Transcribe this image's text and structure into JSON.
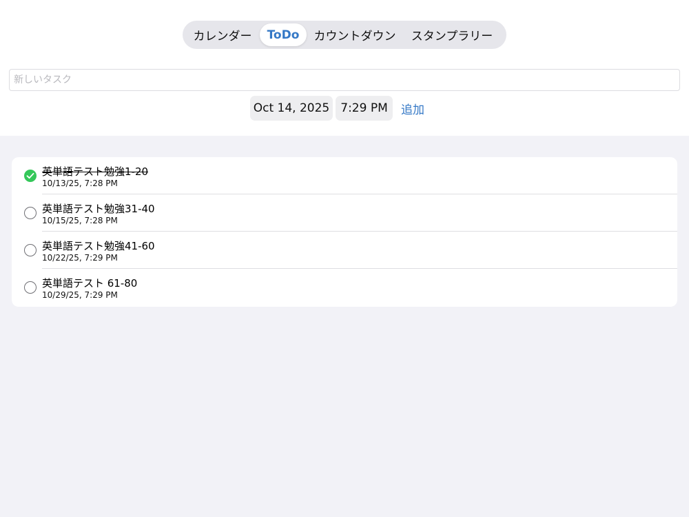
{
  "tabs": [
    {
      "label": "カレンダー",
      "active": false
    },
    {
      "label": "ToDo",
      "active": true
    },
    {
      "label": "カウントダウン",
      "active": false
    },
    {
      "label": "スタンプラリー",
      "active": false
    }
  ],
  "new_task": {
    "placeholder": "新しいタスク",
    "value": ""
  },
  "date_picker": {
    "value": "Oct 14, 2025"
  },
  "time_picker": {
    "value": "7:29 PM"
  },
  "add_button": {
    "label": "追加"
  },
  "colors": {
    "accent": "#3478c6",
    "done_green": "#34c759",
    "background": "#f2f2f7"
  },
  "tasks": [
    {
      "title": "英単語テスト勉強1-20",
      "due": "10/13/25, 7:28 PM",
      "completed": true,
      "icon": "checkmark-circle-icon"
    },
    {
      "title": "英単語テスト勉強31-40",
      "due": "10/15/25, 7:28 PM",
      "completed": false,
      "icon": "empty-circle-icon"
    },
    {
      "title": "英単語テスト勉強41-60",
      "due": "10/22/25, 7:29 PM",
      "completed": false,
      "icon": "empty-circle-icon"
    },
    {
      "title": "英単語テスト 61-80",
      "due": "10/29/25, 7:29 PM",
      "completed": false,
      "icon": "empty-circle-icon"
    }
  ]
}
